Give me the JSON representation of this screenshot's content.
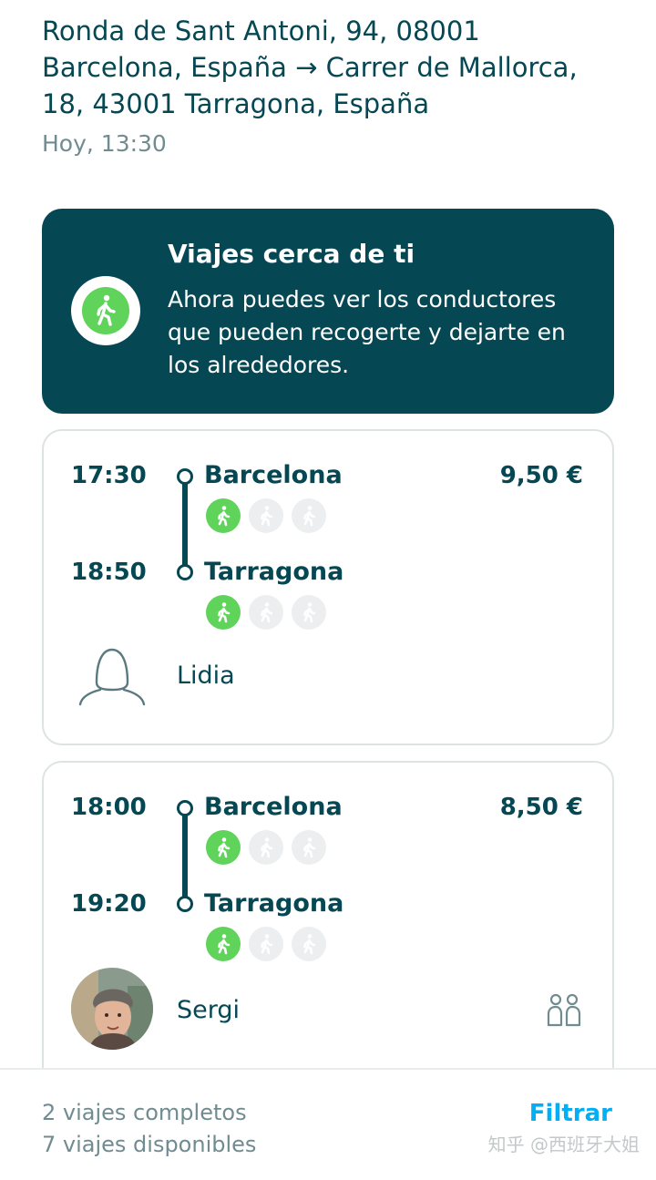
{
  "header": {
    "route": "Ronda de Sant Antoni, 94, 08001 Barcelona, España → Carrer de Mallorca, 18, 43001 Tarragona, España",
    "date": "Hoy, 13:30"
  },
  "promo": {
    "icon": "walking-person-icon",
    "title": "Viajes cerca de ti",
    "text": "Ahora puedes ver los conductores que pueden recogerte y dejarte en los alrededores."
  },
  "trips": [
    {
      "departure_time": "17:30",
      "departure_city": "Barcelona",
      "arrival_time": "18:50",
      "arrival_city": "Tarragona",
      "price": "9,50 €",
      "driver": "Lidia",
      "pickup_proximity": 1,
      "dropoff_proximity": 1
    },
    {
      "departure_time": "18:00",
      "departure_city": "Barcelona",
      "arrival_time": "19:20",
      "arrival_city": "Tarragona",
      "price": "8,50 €",
      "driver": "Sergi",
      "pickup_proximity": 1,
      "dropoff_proximity": 1
    }
  ],
  "footer": {
    "completed": "2 viajes completos",
    "available": "7 viajes disponibles",
    "filter_label": "Filtrar",
    "watermark": "知乎 @西班牙大姐"
  },
  "colors": {
    "primary": "#054752",
    "accent_green": "#5fd35a",
    "link_blue": "#00aff5",
    "muted": "#708c91"
  }
}
